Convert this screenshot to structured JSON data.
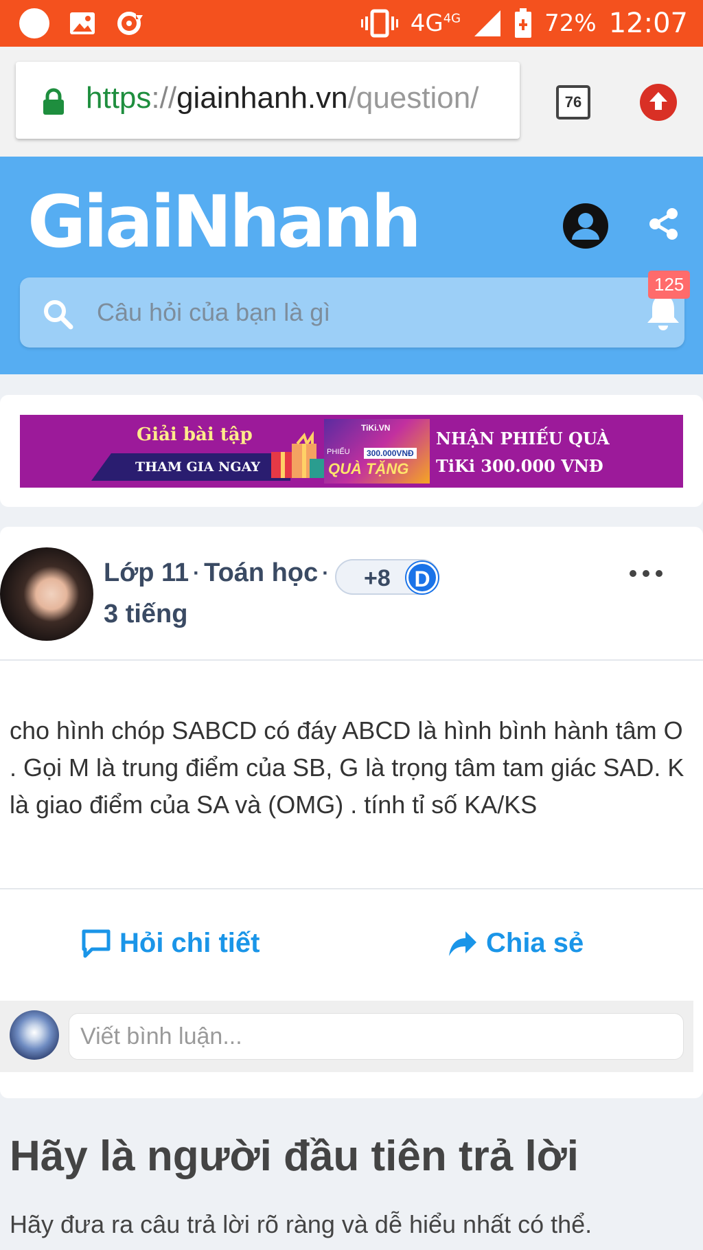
{
  "status_bar": {
    "network": "4G",
    "network_sup": "4G",
    "battery": "72%",
    "time": "12:07",
    "icons": [
      "notification-dot-icon",
      "image-icon",
      "sync-icon",
      "vibrate-icon",
      "signal-icon",
      "battery-charging-icon"
    ]
  },
  "browser": {
    "url_scheme": "https",
    "url_sep": "://",
    "url_host": "giainhanh.vn",
    "url_path": "/question/",
    "tab_count": "76",
    "icons": [
      "lock-icon",
      "tabs-icon",
      "upload-icon"
    ]
  },
  "header": {
    "logo": "GiaiNhanh",
    "search_placeholder": "Câu hỏi của bạn là gì",
    "notification_count": "125",
    "icons": [
      "user-icon",
      "share-icon",
      "search-icon",
      "bell-icon"
    ]
  },
  "banner": {
    "title": "Giải bài tập",
    "cta": "THAM GIA NGAY",
    "voucher_brand": "TiKi.VN",
    "voucher_label": "PHIẾU",
    "voucher_amount": "300.000VNĐ",
    "voucher_title": "QUÀ TẶNG",
    "right_line1": "NHẬN PHIẾU QUÀ",
    "right_line2": "TiKi 300.000 VNĐ",
    "colors": {
      "background": "#9c1a9a",
      "accent": "#ffeb8a"
    }
  },
  "question": {
    "grade": "Lớp 11",
    "subject": "Toán học",
    "dot": "·",
    "points": "+8",
    "level": "D",
    "time_ago": "3 tiếng",
    "text": "cho hình chóp SABCD có đáy ABCD là hình bình hành tâm O . Gọi M là trung điểm của SB, G là trọng tâm tam giác SAD. K là giao điểm của SA và (OMG) . tính tỉ số KA/KS",
    "ask_detail_label": "Hỏi chi tiết",
    "share_label": "Chia sẻ",
    "comment_placeholder": "Viết bình luận..."
  },
  "answers": {
    "title": "Hãy là người đầu tiên trả lời",
    "subtitle": "Hãy đưa ra câu trả lời rõ ràng và dễ hiểu nhất có thể."
  },
  "colors": {
    "status_bar": "#f4511e",
    "header": "#56adf2",
    "link_blue": "#1a95e8"
  }
}
